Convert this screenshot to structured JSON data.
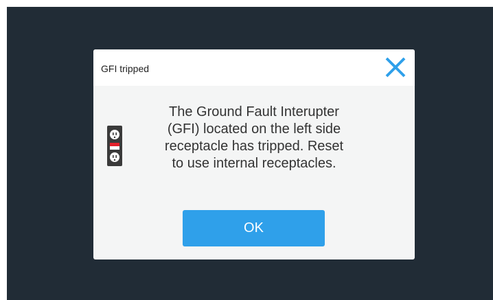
{
  "dialog": {
    "title": "GFI tripped",
    "close_icon": "close-icon",
    "receptacle_icon": "gfi-receptacle-icon",
    "message": "The Ground Fault Interupter (GFI) located on the left side receptacle has tripped. Reset to use internal receptacles.",
    "ok_label": "OK"
  },
  "colors": {
    "backdrop": "#212c36",
    "dialog_body": "#f4f5f5",
    "header": "#ffffff",
    "accent": "#2fa0ea",
    "gfi_indicator": "#e4202a"
  }
}
